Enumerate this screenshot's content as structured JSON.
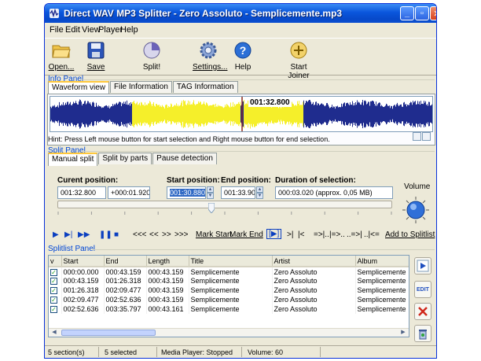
{
  "window": {
    "title": "Direct WAV MP3 Splitter - Zero Assoluto - Semplicemente.mp3",
    "colors": {
      "title_bar": "#0a56dc",
      "window_bg": "#ece9d8",
      "selection": "#f5ef2a",
      "wave": "#1f2c8e",
      "accent_blue": "#0046d5"
    }
  },
  "menu": {
    "items": [
      "File",
      "Edit",
      "View",
      "Player",
      "Help"
    ]
  },
  "toolbar": {
    "open": "Open...",
    "save": "Save",
    "split": "Split!",
    "settings": "Settings...",
    "help": "Help",
    "start_joiner": "Start Joiner"
  },
  "info_panel": {
    "label": "Info Panel",
    "tabs": [
      "Waveform view",
      "File Information",
      "TAG Information"
    ],
    "marker_time": "001:32.800",
    "hint": "Hint: Press Left mouse button for start selection and Right mouse button for end selection."
  },
  "split_panel": {
    "label": "Split Panel",
    "tabs": [
      "Manual split",
      "Split by parts",
      "Pause detection"
    ],
    "current_position_label": "Curent position:",
    "current_position": "001:32.800",
    "current_offset": "+000:01.920",
    "start_position_label": "Start position:",
    "start_position": "001:30.880",
    "end_position_label": "End position:",
    "end_position": "001:33.900",
    "duration_label": "Duration of selection:",
    "duration": "000:03.020  (approx. 0,05 MB)",
    "volume_label": "Volume",
    "slider_position": 0.46
  },
  "transport": {
    "mark_start": "Mark Start",
    "mark_end": "Mark End",
    "add_to_splitlist": "Add to Splitlist",
    "rewind_glyphs": [
      "<<<",
      "<<",
      ">>",
      ">>>"
    ],
    "jump_glyphs": [
      ">|",
      "|<"
    ],
    "join_glyphs": [
      "=>|..",
      "|=>..",
      "..=>|",
      "..|<="
    ]
  },
  "splitlist": {
    "label": "Splitlist Panel",
    "columns": [
      "v",
      "Start",
      "End",
      "Length",
      "Title",
      "Artist",
      "Album"
    ],
    "rows": [
      {
        "start": "000:00.000",
        "end": "000:43.159",
        "length": "000:43.159",
        "title": "Semplicemente",
        "artist": "Zero Assoluto",
        "album": "Semplicemente"
      },
      {
        "start": "000:43.159",
        "end": "001:26.318",
        "length": "000:43.159",
        "title": "Semplicemente",
        "artist": "Zero Assoluto",
        "album": "Semplicemente"
      },
      {
        "start": "001:26.318",
        "end": "002:09.477",
        "length": "000:43.159",
        "title": "Semplicemente",
        "artist": "Zero Assoluto",
        "album": "Semplicemente"
      },
      {
        "start": "002:09.477",
        "end": "002:52.636",
        "length": "000:43.159",
        "title": "Semplicemente",
        "artist": "Zero Assoluto",
        "album": "Semplicemente"
      },
      {
        "start": "002:52.636",
        "end": "003:35.797",
        "length": "000:43.161",
        "title": "Semplicemente",
        "artist": "Zero Assoluto",
        "album": "Semplicemente"
      }
    ],
    "side_buttons": [
      "play-icon",
      "edit-icon",
      "delete-icon",
      "recycle-icon"
    ],
    "edit_label": "EDIT"
  },
  "status": {
    "sections": "5 section(s)",
    "selected": "5 selected",
    "player": "Media Player: Stopped",
    "volume": "Volume: 60"
  }
}
